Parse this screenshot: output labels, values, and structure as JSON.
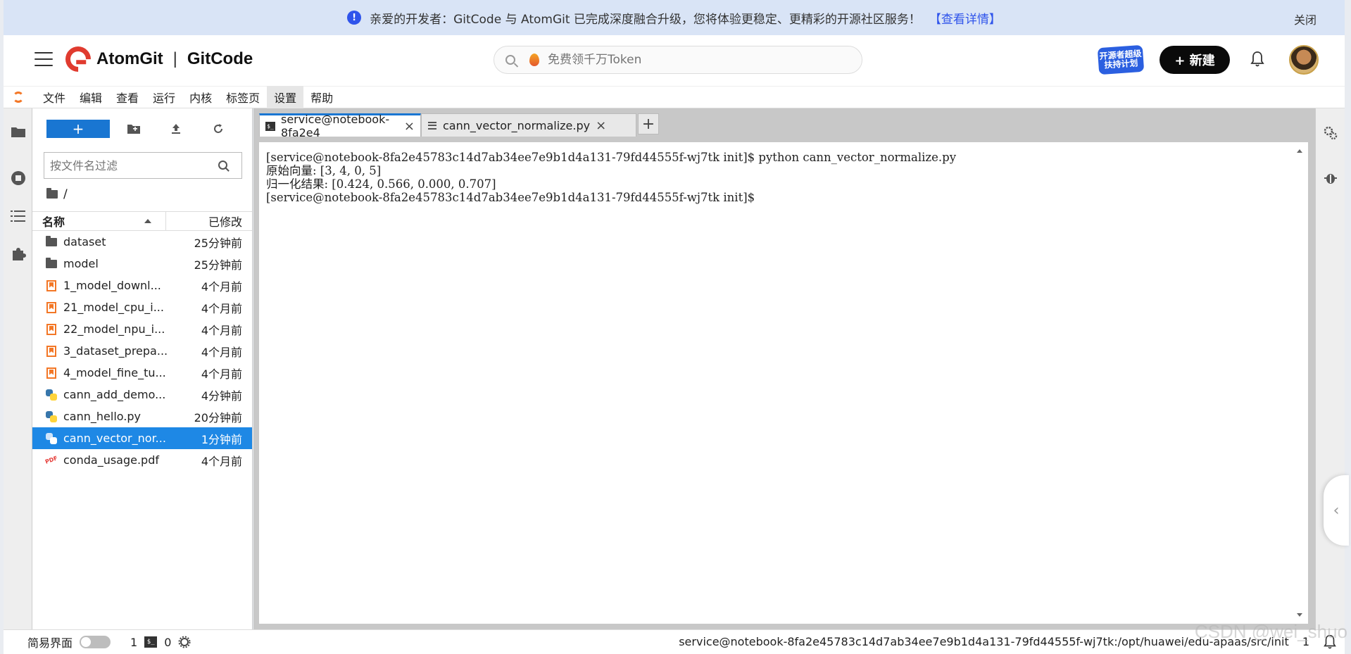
{
  "banner": {
    "message": "亲爱的开发者：GitCode 与 AtomGit 已完成深度融合升级，您将体验更稳定、更精彩的开源社区服务！",
    "link": "【查看详情】",
    "close": "关闭"
  },
  "header": {
    "brand_left": "AtomGit",
    "brand_sep": "|",
    "brand_right": "GitCode",
    "search_placeholder": "免费领千万Token",
    "promo": "开源者超级扶持计划",
    "new_button": "+ 新建"
  },
  "menu": [
    "文件",
    "编辑",
    "查看",
    "运行",
    "内核",
    "标签页",
    "设置",
    "帮助"
  ],
  "filebrowser": {
    "filter_placeholder": "按文件名过滤",
    "path": "/",
    "col_name": "名称",
    "col_modified": "已修改",
    "files": [
      {
        "name": "dataset",
        "modified": "25分钟前",
        "type": "folder"
      },
      {
        "name": "model",
        "modified": "25分钟前",
        "type": "folder"
      },
      {
        "name": "1_model_downl...",
        "modified": "4个月前",
        "type": "notebook"
      },
      {
        "name": "21_model_cpu_i...",
        "modified": "4个月前",
        "type": "notebook"
      },
      {
        "name": "22_model_npu_i...",
        "modified": "4个月前",
        "type": "notebook"
      },
      {
        "name": "3_dataset_prepa...",
        "modified": "4个月前",
        "type": "notebook"
      },
      {
        "name": "4_model_fine_tu...",
        "modified": "4个月前",
        "type": "notebook"
      },
      {
        "name": "cann_add_demo...",
        "modified": "4分钟前",
        "type": "python"
      },
      {
        "name": "cann_hello.py",
        "modified": "20分钟前",
        "type": "python"
      },
      {
        "name": "cann_vector_nor...",
        "modified": "1分钟前",
        "type": "python",
        "selected": true
      },
      {
        "name": "conda_usage.pdf",
        "modified": "4个月前",
        "type": "pdf"
      }
    ]
  },
  "tabs": [
    {
      "label": "service@notebook-8fa2e4",
      "active": true
    },
    {
      "label": "cann_vector_normalize.py",
      "active": false
    }
  ],
  "terminal": {
    "lines": [
      "[service@notebook-8fa2e45783c14d7ab34ee7e9b1d4a131-79fd44555f-wj7tk init]$ python cann_vector_normalize.py",
      "原始向量: [3, 4, 0, 5]",
      "归一化结果: [0.424, 0.566, 0.000, 0.707]",
      "[service@notebook-8fa2e45783c14d7ab34ee7e9b1d4a131-79fd44555f-wj7tk init]$"
    ]
  },
  "statusbar": {
    "simple_mode": "简易界面",
    "count1": "1",
    "term_label": "$_",
    "count2": "0",
    "path": "service@notebook-8fa2e45783c14d7ab34ee7e9b1d4a131-79fd44555f-wj7tk:/opt/huawei/edu-apaas/src/init",
    "page": "1"
  },
  "watermark": "CSDN @wei_shuo"
}
